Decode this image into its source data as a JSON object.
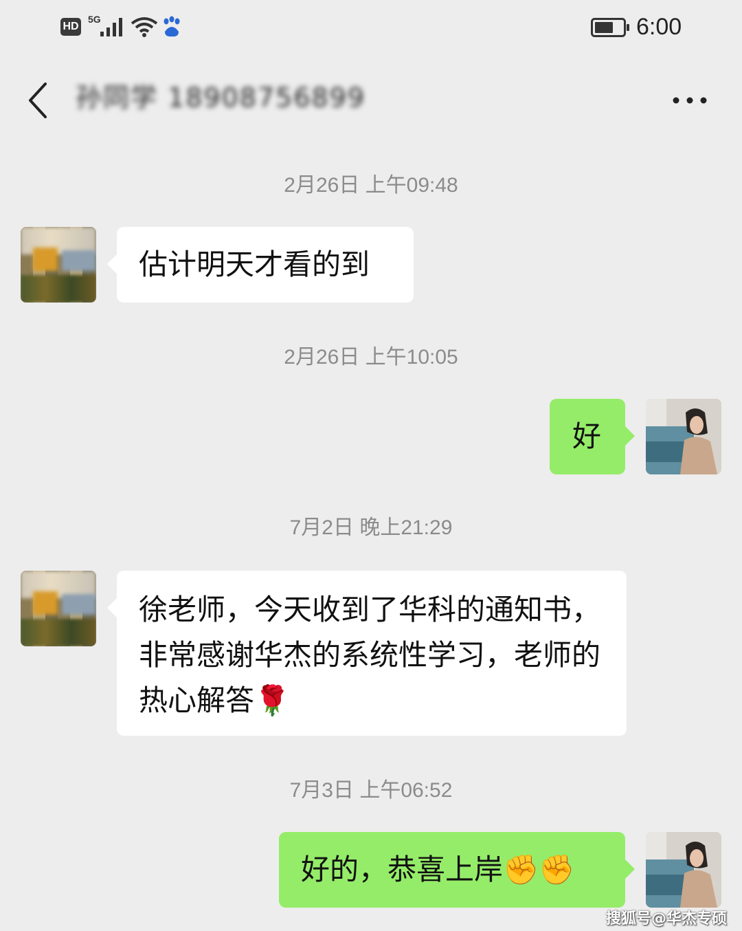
{
  "status_bar": {
    "hd_label": "HD",
    "network_label": "5G",
    "time": "6:00",
    "icons": [
      "signal-icon",
      "wifi-icon",
      "baidu-app-icon",
      "battery-icon"
    ]
  },
  "header": {
    "contact_name": "孙同学 18908756899",
    "back_icon": "chevron-left-icon",
    "more_icon": "more-dots-icon"
  },
  "messages": [
    {
      "kind": "timestamp",
      "text": "2月26日 上午09:48"
    },
    {
      "kind": "message",
      "side": "left",
      "text": "估计明天才看的到"
    },
    {
      "kind": "timestamp",
      "text": "2月26日 上午10:05"
    },
    {
      "kind": "message",
      "side": "right",
      "text": "好"
    },
    {
      "kind": "timestamp",
      "text": "7月2日 晚上21:29"
    },
    {
      "kind": "message",
      "side": "left",
      "text": "徐老师，今天收到了华科的通知书，非常感谢华杰的系统性学习，老师的热心解答🌹"
    },
    {
      "kind": "timestamp",
      "text": "7月3日 上午06:52"
    },
    {
      "kind": "message",
      "side": "right",
      "text": "好的，恭喜上岸✊✊"
    }
  ],
  "watermark": "搜狐号@华杰专硕",
  "colors": {
    "background": "#ededed",
    "sent_bubble": "#95ec69",
    "received_bubble": "#ffffff",
    "timestamp_text": "#8b8b8b"
  }
}
